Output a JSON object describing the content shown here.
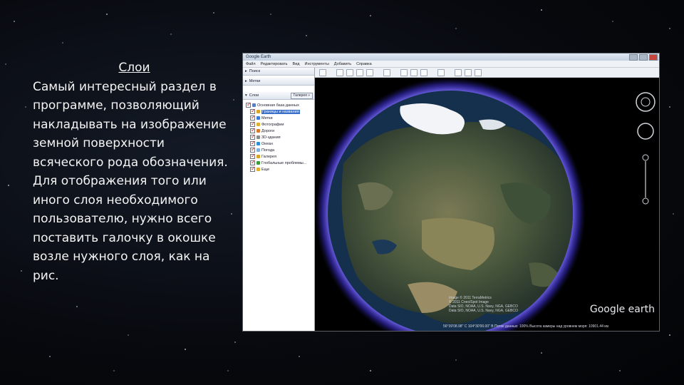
{
  "slide": {
    "title": "Слои",
    "body": "Самый интересный раздел в программе, позволяющий накладывать на изображение земной поверхности всяческого рода обозначения. Для отображения того или иного слоя необходимого пользователю, нужно всего поставить галочку в окошке возле нужного слоя, как на рис."
  },
  "app": {
    "title": "Google Earth",
    "menu": [
      "Файл",
      "Редактировать",
      "Вид",
      "Инструменты",
      "Добавить",
      "Справка"
    ],
    "panels": {
      "search": "Поиск",
      "places": "Метки",
      "layers": "Слои",
      "gallery_button": "Галерея »"
    },
    "layers": [
      {
        "label": "Основная база данных",
        "checked": true,
        "indent": false,
        "color": "#5a7fc0"
      },
      {
        "label": "Границы и названия",
        "checked": true,
        "indent": true,
        "selected": true,
        "color": "#d9a326"
      },
      {
        "label": "Метки",
        "checked": true,
        "indent": true,
        "color": "#3a7bd5"
      },
      {
        "label": "Фотографии",
        "checked": true,
        "indent": true,
        "color": "#e0b030"
      },
      {
        "label": "Дороги",
        "checked": true,
        "indent": true,
        "color": "#d47a2a"
      },
      {
        "label": "3D-здания",
        "checked": true,
        "indent": true,
        "color": "#8a8a8a"
      },
      {
        "label": "Океан",
        "checked": true,
        "indent": true,
        "color": "#2e8fd1"
      },
      {
        "label": "Погода",
        "checked": true,
        "indent": true,
        "color": "#7fb2e0"
      },
      {
        "label": "Галерея",
        "checked": true,
        "indent": true,
        "color": "#d9a326"
      },
      {
        "label": "Глобальные проблемы...",
        "checked": true,
        "indent": true,
        "color": "#3d9a3d"
      },
      {
        "label": "Еще",
        "checked": true,
        "indent": true,
        "color": "#e0b030"
      }
    ],
    "logo": "Google earth",
    "credits": [
      "Image © 2011 TerraMetrics",
      "© 2011 Cnes/Spot Image",
      "Data SIO, NOAA, U.S. Navy, NGA, GEBCO",
      "Data SIO, NOAA, U.S. Navy, NGA, GEBCO"
    ],
    "status": "56°39'08.98\" С 104°30'00.00\" В   Поток данных: 100%   Высота камеры над уровнем моря: 10901.44 км"
  },
  "colors": {
    "text": "#f4f4f4",
    "background": "#07090e",
    "atmosphere": "#6a5cff",
    "ocean": "#15304c"
  }
}
